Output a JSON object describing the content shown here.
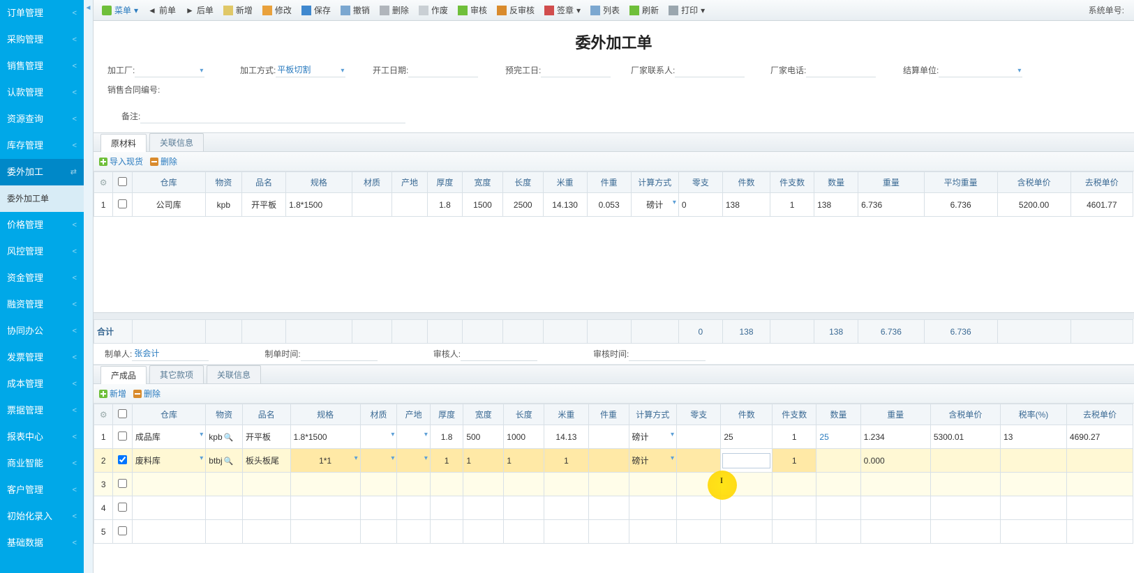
{
  "sidebar": {
    "items": [
      {
        "label": "订单管理",
        "open": true
      },
      {
        "label": "采购管理"
      },
      {
        "label": "销售管理"
      },
      {
        "label": "认款管理"
      },
      {
        "label": "资源查询"
      },
      {
        "label": "库存管理"
      },
      {
        "label": "委外加工",
        "active": true,
        "icon": "swap"
      },
      {
        "label": "价格管理"
      },
      {
        "label": "风控管理"
      },
      {
        "label": "资金管理"
      },
      {
        "label": "融资管理"
      },
      {
        "label": "协同办公"
      },
      {
        "label": "发票管理"
      },
      {
        "label": "成本管理"
      },
      {
        "label": "票据管理"
      },
      {
        "label": "报表中心"
      },
      {
        "label": "商业智能"
      },
      {
        "label": "客户管理"
      },
      {
        "label": "初始化录入"
      },
      {
        "label": "基础数据"
      }
    ],
    "sub": "委外加工单"
  },
  "toolbar": {
    "menu": "菜单",
    "prev": "前单",
    "next": "后单",
    "new": "新增",
    "edit": "修改",
    "save": "保存",
    "revoke": "撤销",
    "del": "删除",
    "abandon": "作废",
    "audit": "审核",
    "unaudit": "反审核",
    "sign": "签章",
    "list": "列表",
    "refresh": "刷新",
    "print": "打印",
    "sysno_label": "系统单号:"
  },
  "title": "委外加工单",
  "form": {
    "factory_label": "加工厂:",
    "factory": "",
    "method_label": "加工方式:",
    "method": "平板切割",
    "start_label": "开工日期:",
    "start": "",
    "finish_label": "预完工日:",
    "finish": "",
    "contact_label": "厂家联系人:",
    "contact": "",
    "phone_label": "厂家电话:",
    "phone": "",
    "settle_label": "结算单位:",
    "settle": "",
    "contract_label": "销售合同编号:",
    "remark_label": "备注:",
    "remark": ""
  },
  "tabs_a": {
    "raw": "原材料",
    "rel": "关联信息"
  },
  "grid_a_toolbar": {
    "import": "导入现货",
    "del": "删除"
  },
  "grid_a": {
    "headers": [
      "",
      "",
      "仓库",
      "物资",
      "品名",
      "规格",
      "材质",
      "产地",
      "厚度",
      "宽度",
      "长度",
      "米重",
      "件重",
      "计算方式",
      "零支",
      "件数",
      "件支数",
      "数量",
      "重量",
      "平均重量",
      "含税单价",
      "去税单价"
    ],
    "rows": [
      {
        "idx": "1",
        "chk": false,
        "warehouse": "公司库",
        "res": "kpb",
        "name": "开平板",
        "spec": "1.8*1500",
        "mat": "",
        "origin": "",
        "thick": "1.8",
        "width": "1500",
        "len": "2500",
        "mw": "14.130",
        "pw": "0.053",
        "calc": "磅计",
        "loose": "0",
        "pcs": "138",
        "perpcs": "1",
        "qty": "138",
        "wt": "6.736",
        "avg": "6.736",
        "price": "5200.00",
        "net": "4601.77"
      }
    ],
    "totals": {
      "label": "合计",
      "loose": "0",
      "pcs": "138",
      "qty": "138",
      "wt": "6.736",
      "avg": "6.736"
    }
  },
  "audit": {
    "creator_label": "制单人:",
    "creator": "张会计",
    "ctime_label": "制单时间:",
    "ctime": "",
    "auditor_label": "审核人:",
    "auditor": "",
    "atime_label": "审核时间:",
    "atime": ""
  },
  "tabs_b": {
    "prod": "产成品",
    "other": "其它款项",
    "rel": "关联信息"
  },
  "grid_b_toolbar": {
    "new": "新增",
    "del": "删除"
  },
  "grid_b": {
    "headers": [
      "",
      "",
      "仓库",
      "物资",
      "品名",
      "规格",
      "材质",
      "产地",
      "厚度",
      "宽度",
      "长度",
      "米重",
      "件重",
      "计算方式",
      "零支",
      "件数",
      "件支数",
      "数量",
      "重量",
      "含税单价",
      "税率(%)",
      "去税单价"
    ],
    "rows": [
      {
        "idx": "1",
        "chk": false,
        "warehouse": "成品库",
        "res": "kpb",
        "name": "开平板",
        "spec": "1.8*1500",
        "mat": "",
        "origin": "",
        "thick": "1.8",
        "width": "500",
        "len": "1000",
        "mw": "14.13",
        "pw": "",
        "calc": "磅计",
        "loose": "",
        "pcs": "25",
        "perpcs": "1",
        "qty": "25",
        "wt": "1.234",
        "price": "5300.01",
        "tax": "13",
        "net": "4690.27"
      },
      {
        "idx": "2",
        "chk": true,
        "warehouse": "废料库",
        "res": "btbj",
        "name": "板头板尾",
        "spec": "1*1",
        "mat": "",
        "origin": "",
        "thick": "1",
        "width": "1",
        "len": "1",
        "mw": "1",
        "pw": "",
        "calc": "磅计",
        "loose": "",
        "pcs": "",
        "perpcs": "1",
        "qty": "",
        "wt": "0.000",
        "price": "",
        "tax": "",
        "net": ""
      },
      {
        "idx": "3",
        "chk": false
      },
      {
        "idx": "4",
        "chk": false
      },
      {
        "idx": "5",
        "chk": false
      }
    ]
  }
}
